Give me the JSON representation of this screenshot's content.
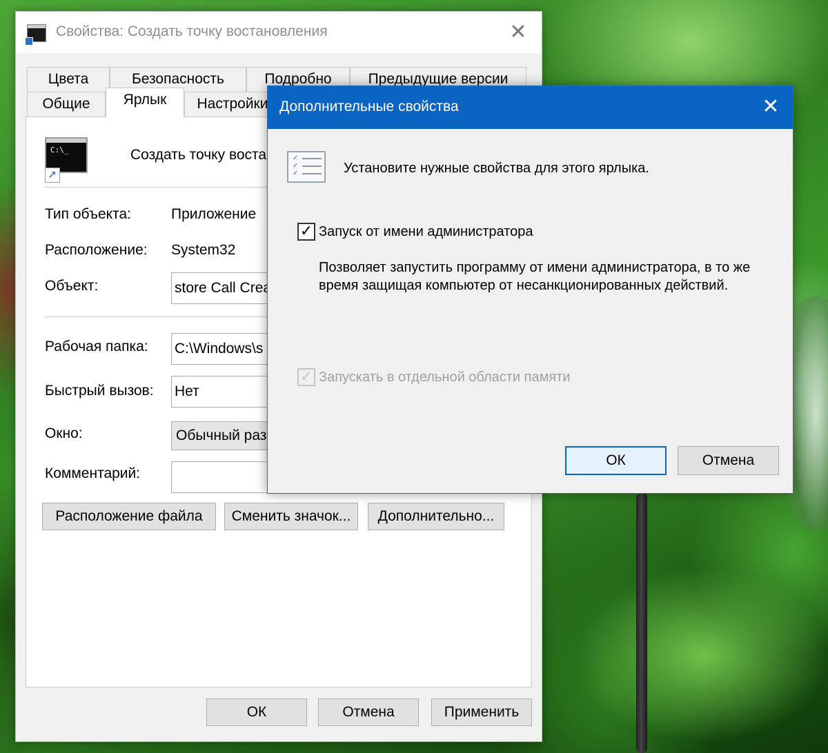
{
  "main_window": {
    "title": "Свойства: Создать точку востановления",
    "close_glyph": "✕",
    "tabs_row1": [
      "Цвета",
      "Безопасность",
      "Подробно",
      "Предыдущие версии"
    ],
    "tabs_row2": [
      "Общие",
      "Ярлык",
      "Настройки"
    ],
    "active_tab": "Ярлык",
    "shortcut_name": "Создать точку востановления",
    "icon_text": "C:\\_",
    "fields": {
      "type_label": "Тип объекта:",
      "type_value": "Приложение",
      "location_label": "Расположение:",
      "location_value": "System32",
      "target_label": "Объект:",
      "target_value": "store Call Create",
      "workdir_label": "Рабочая папка:",
      "workdir_value": "C:\\Windows\\s",
      "hotkey_label": "Быстрый вызов:",
      "hotkey_value": "Нет",
      "window_label": "Окно:",
      "window_value": "Обычный раз",
      "comment_label": "Комментарий:",
      "comment_value": ""
    },
    "buttons": {
      "open_location": "Расположение файла",
      "change_icon": "Сменить значок...",
      "advanced": "Дополнительно..."
    },
    "footer": {
      "ok": "ОК",
      "cancel": "Отмена",
      "apply": "Применить"
    }
  },
  "dialog": {
    "title": "Дополнительные свойства",
    "close_glyph": "✕",
    "instruction": "Установите нужные свойства для этого ярлыка.",
    "run_as_admin": {
      "label": "Запуск от имени администратора",
      "checked": true,
      "description": "Позволяет запустить программу от имени администратора, в то же время защищая компьютер от несанкционированных действий."
    },
    "separate_memory": {
      "label": "Запускать в отдельной области памяти",
      "checked": true,
      "enabled": false
    },
    "ok": "ОК",
    "cancel": "Отмена"
  }
}
